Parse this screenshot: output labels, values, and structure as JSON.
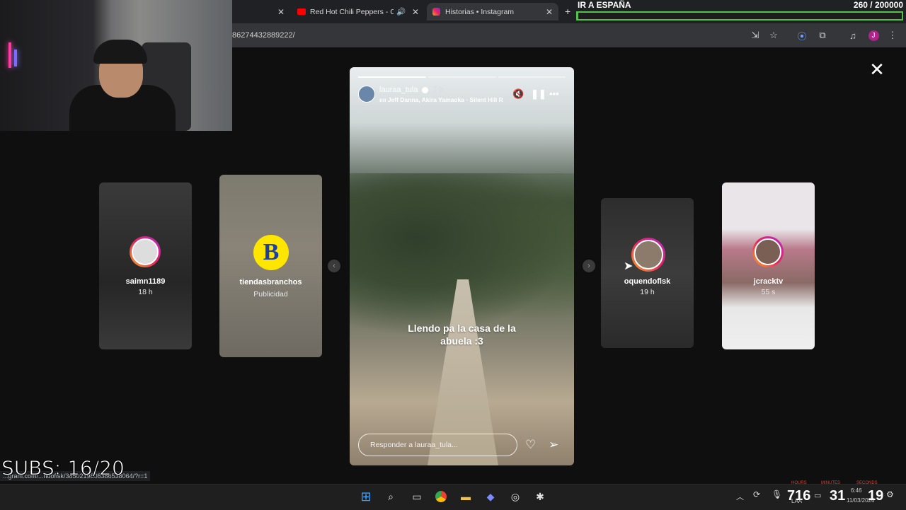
{
  "browser": {
    "tabs": [
      {
        "title": "Red Hot Chili Peppers - Cali",
        "icon": "youtube-icon",
        "muted_icon": "speaker-icon"
      },
      {
        "title": "Historias • Instagram",
        "icon": "instagram-icon"
      }
    ],
    "new_tab": "+",
    "url": "86274432889222/"
  },
  "goal": {
    "title": "IR A ESPAÑA",
    "count": "260 / 200000",
    "progress": 0.0013
  },
  "stories": {
    "left": [
      {
        "name": "saimn1189",
        "time": "18 h"
      },
      {
        "name": "tiendasbranchos",
        "time": "Publicidad",
        "logo": "B"
      }
    ],
    "right": [
      {
        "name": "oquendoflsk",
        "time": "19 h"
      },
      {
        "name": "jcracktv",
        "time": "55 s"
      }
    ],
    "main": {
      "user": "lauraa_tula",
      "time": "7 h",
      "music": "Jeff Danna, Akira Yamaoka · Silent Hill R",
      "caption": "Llendo pa la casa de la abuela :3",
      "reply_placeholder": "Responder a lauraa_tula..."
    }
  },
  "overlay": {
    "subs": "SUBS: 16/20"
  },
  "statusbar": {
    "url": "...gram.com/...ndoflsk/3850219808386538064/?r=1"
  },
  "taskbar": {
    "stat1": "716",
    "stat2": "31",
    "stat3": "19",
    "clock_time": "6:46",
    "clock_date": "11/03/2026",
    "lang": "LAA",
    "labels": [
      "HOURS",
      "MINUTES",
      "SECONDS"
    ]
  }
}
